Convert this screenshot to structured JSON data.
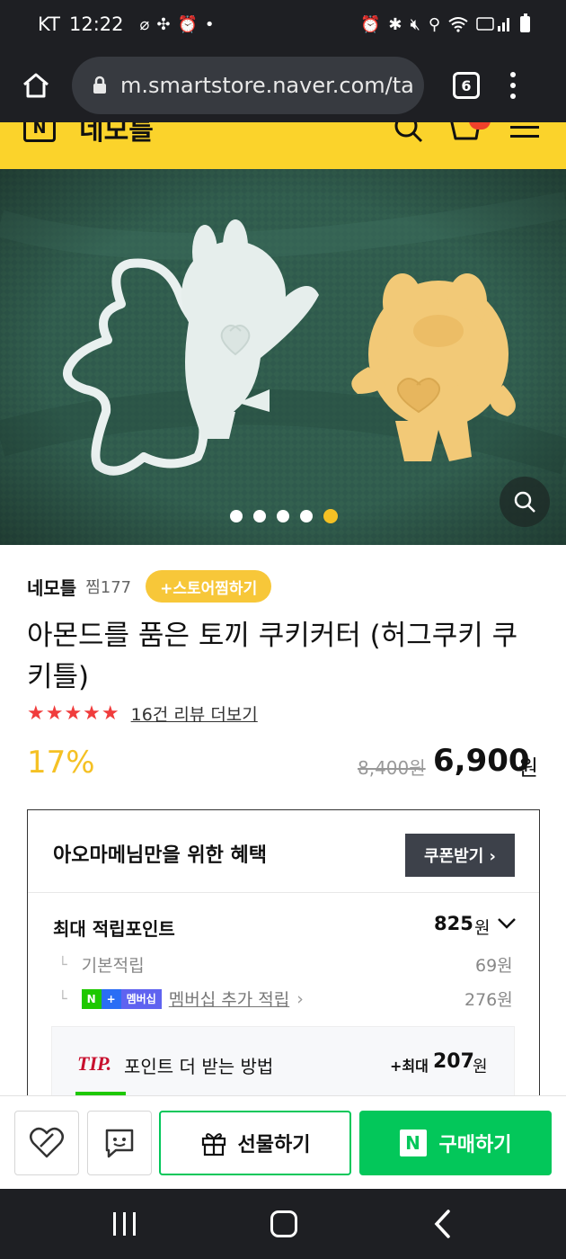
{
  "status_bar": {
    "carrier": "KT",
    "time": "12:22"
  },
  "browser": {
    "url": "m.smartstore.naver.com/ta",
    "tab_count": "6"
  },
  "store_header": {
    "logo_letter": "N",
    "store_name": "네모틀"
  },
  "gallery": {
    "total_images": 5,
    "active_index": 5
  },
  "product": {
    "store_name": "네모틀",
    "zzim_count": "찜177",
    "store_zzim_label": "+스토어찜하기",
    "title": "아몬드를 품은 토끼 쿠키커터 (허그쿠키 쿠키틀)",
    "stars": "★★★★★",
    "rating_stars": 5,
    "review_link": "16건 리뷰 더보기",
    "discount": "17%",
    "original_price": "8,400원",
    "price": "6,900",
    "price_unit": "원"
  },
  "benefits": {
    "title": "아오마메님만을 위한 혜택",
    "coupon_button": "쿠폰받기 ›",
    "max_points_label": "최대 적립포인트",
    "max_points_value": "825",
    "max_points_unit": "원",
    "basic_label": "기본적립",
    "basic_value": "69원",
    "membership_badge_n": "N",
    "membership_badge_plus": "+",
    "membership_badge_text": "멤버십",
    "membership_label": "멤버십 추가 적립",
    "membership_value": "276원",
    "branch_glyph": "└",
    "tip_label": "TIP.",
    "tip_text": "포인트 더 받는 방법",
    "tip_max": "+최대",
    "tip_value": "207",
    "tip_unit": "원"
  },
  "actions": {
    "gift_label": "선물하기",
    "buy_badge": "N",
    "buy_label": "구매하기"
  },
  "colors": {
    "store_yellow": "#fbd32b",
    "naver_green": "#03c75a",
    "discount_yellow": "#f5c124",
    "star_red": "#f03c3c",
    "system_bar": "#1e1f23"
  }
}
